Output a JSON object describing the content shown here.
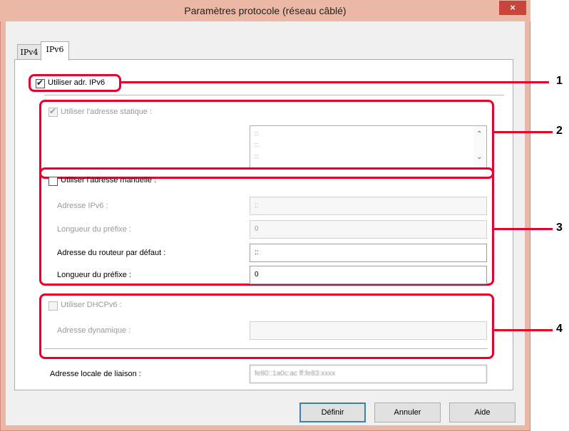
{
  "window": {
    "title": "Paramètres protocole (réseau câblé)",
    "close_glyph": "×"
  },
  "tabs": [
    {
      "label": "IPv4"
    },
    {
      "label": "IPv6"
    }
  ],
  "ipv6": {
    "use_ipv6": {
      "label": "Utiliser adr. IPv6",
      "checked": true
    },
    "static": {
      "label": "Utiliser l'adresse statique :",
      "checked": true,
      "enabled": false,
      "list": [
        "::",
        "::",
        "::"
      ]
    },
    "manual": {
      "label": "Utiliser l'adresse manuelle :",
      "checked": false,
      "ipv6_address_label": "Adresse IPv6 :",
      "ipv6_address_value": "::",
      "prefix_label_1": "Longueur du préfixe :",
      "prefix_value_1": "0",
      "router_label": "Adresse du routeur par défaut :",
      "router_value": "::",
      "prefix_label_2": "Longueur du préfixe :",
      "prefix_value_2": "0"
    },
    "dhcp": {
      "label": "Utiliser DHCPv6 :",
      "checked": false,
      "enabled": false,
      "dynamic_label": "Adresse dynamique :",
      "dynamic_value": "",
      "linklocal_label": "Adresse locale de liaison :",
      "linklocal_value": "fe80::1a0c:ac ff:fe83:xxxx"
    }
  },
  "buttons": {
    "define": "Définir",
    "cancel": "Annuler",
    "help": "Aide"
  },
  "callouts": [
    "1",
    "2",
    "3",
    "4"
  ],
  "colors": {
    "callout": "#e8002d",
    "titlebar": "#ecb8a6",
    "close": "#c7453b"
  }
}
